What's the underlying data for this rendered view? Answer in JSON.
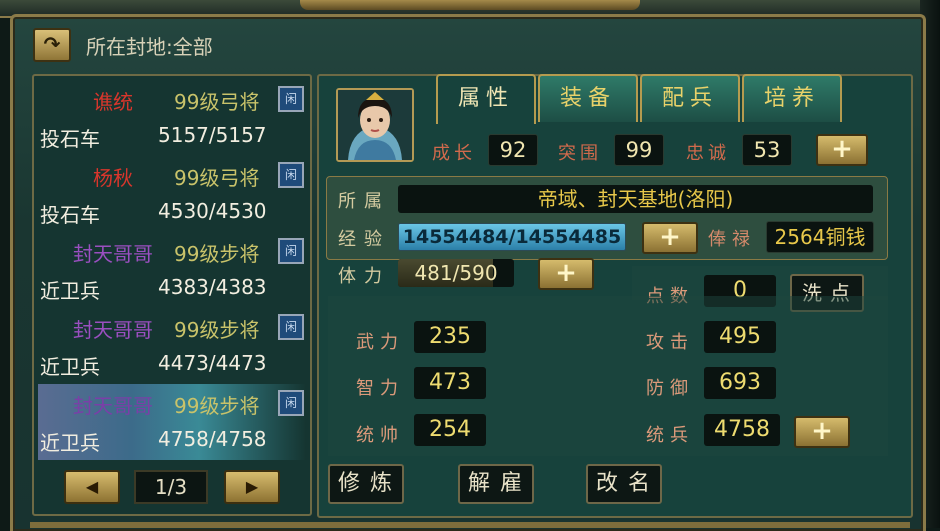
{
  "header": {
    "fief_label": "所在封地:全部",
    "back_icon": "back-arrow-icon"
  },
  "generals": [
    {
      "name": "谯统",
      "name_color": "#d8362c",
      "rank": "99级弓将",
      "dismiss": "闲",
      "unit": "投石车",
      "troops": "5157/5157",
      "selected": false
    },
    {
      "name": "杨秋",
      "name_color": "#d8362c",
      "rank": "99级弓将",
      "dismiss": "闲",
      "unit": "投石车",
      "troops": "4530/4530",
      "selected": false
    },
    {
      "name": "封天哥哥",
      "name_color": "#9a4fc0",
      "rank": "99级步将",
      "dismiss": "闲",
      "unit": "近卫兵",
      "troops": "4383/4383",
      "selected": false
    },
    {
      "name": "封天哥哥",
      "name_color": "#9a4fc0",
      "rank": "99级步将",
      "dismiss": "闲",
      "unit": "近卫兵",
      "troops": "4473/4473",
      "selected": false
    },
    {
      "name": "封天哥哥",
      "name_color": "#7a3fa8",
      "rank": "99级步将",
      "dismiss": "闲",
      "unit": "近卫兵",
      "troops": "4758/4758",
      "selected": true
    }
  ],
  "pager": {
    "page": "1/3"
  },
  "tabs": [
    {
      "label": "属性",
      "active": true
    },
    {
      "label": "装备",
      "active": false
    },
    {
      "label": "配兵",
      "active": false
    },
    {
      "label": "培养",
      "active": false
    }
  ],
  "growth": {
    "growth_label": "成长",
    "growth_value": "92",
    "break_label": "突围",
    "break_value": "99",
    "loyal_label": "忠诚",
    "loyal_value": "53"
  },
  "info": {
    "belong_label": "所属",
    "belong_value": "帝域、封天基地(洛阳)",
    "exp_label": "经验",
    "exp_value": "14554484/14554485",
    "exp_fraction": 0.99999,
    "salary_label": "俸禄",
    "salary_value": "2564铜钱",
    "hp_label": "体力",
    "hp_value": "481/590",
    "hp_fraction": 0.815,
    "points_label": "点数",
    "points_value": "0",
    "wash_label": "洗点"
  },
  "attributes": {
    "wuli_label": "武力",
    "wuli_value": "235",
    "zhili_label": "智力",
    "zhili_value": "473",
    "tongshuai_label": "统帅",
    "tongshuai_value": "254",
    "attack_label": "攻击",
    "attack_value": "495",
    "defense_label": "防御",
    "defense_value": "693",
    "command_label": "统兵",
    "command_value": "4758"
  },
  "actions": {
    "train": "修炼",
    "dismiss": "解雇",
    "rename": "改名"
  }
}
